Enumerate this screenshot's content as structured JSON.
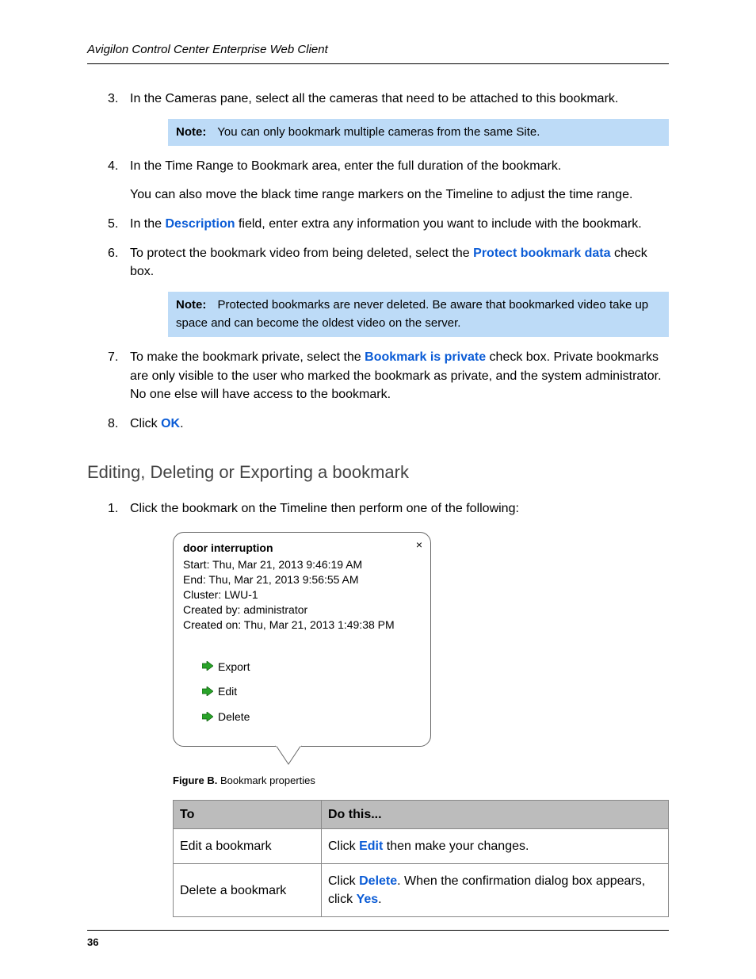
{
  "header": {
    "title": "Avigilon Control Center Enterprise Web Client"
  },
  "steps": {
    "3": {
      "num": "3.",
      "text": "In the Cameras pane, select all the cameras that need to be attached to this bookmark."
    },
    "note1": {
      "label": "Note:",
      "text": "You can only bookmark multiple cameras from the same Site."
    },
    "4": {
      "num": "4.",
      "text": "In the Time Range to Bookmark area, enter the full duration of the bookmark.",
      "after": "You can also move the black time range markers on the Timeline to adjust the time range."
    },
    "5": {
      "num": "5.",
      "pre": "In the ",
      "link": "Description",
      "post": " field, enter extra any information you want to include with the bookmark."
    },
    "6": {
      "num": "6.",
      "pre": "To protect the bookmark video from being deleted, select the ",
      "link": "Protect bookmark data",
      "post": " check box."
    },
    "note2": {
      "label": "Note:",
      "text": "Protected bookmarks are never deleted. Be aware that bookmarked video take up space and can become the oldest video on the server."
    },
    "7": {
      "num": "7.",
      "pre": "To make the bookmark private, select the ",
      "link": "Bookmark is private",
      "post": " check box. Private bookmarks are only visible to the user who marked the bookmark as private, and the system administrator. No one else will have access to the bookmark."
    },
    "8": {
      "num": "8.",
      "pre": "Click ",
      "link": "OK",
      "post": "."
    }
  },
  "section2": {
    "title": "Editing, Deleting or Exporting a bookmark",
    "step1": {
      "num": "1.",
      "text": "Click the bookmark on the Timeline then perform one of the following:"
    }
  },
  "popup": {
    "title": "door interruption",
    "line_start": "Start: Thu, Mar 21, 2013 9:46:19 AM",
    "line_end": "End: Thu, Mar 21, 2013 9:56:55 AM",
    "line_cluster": "Cluster: LWU-1",
    "line_createdby": "Created by: administrator",
    "line_createdon": "Created on: Thu, Mar 21, 2013 1:49:38 PM",
    "actions": {
      "export": "Export",
      "edit": "Edit",
      "delete": "Delete"
    },
    "close": "×"
  },
  "figure": {
    "label": "Figure B.",
    "caption": " Bookmark properties"
  },
  "table": {
    "head": {
      "c1": "To",
      "c2": "Do this..."
    },
    "rows": [
      {
        "c1": "Edit a bookmark",
        "c2_pre": "Click ",
        "c2_link": "Edit",
        "c2_post": " then make your changes."
      },
      {
        "c1": "Delete a bookmark",
        "c2_pre": "Click ",
        "c2_link": "Delete",
        "c2_mid": ". When the confirmation dialog box appears, click ",
        "c2_link2": "Yes",
        "c2_post": "."
      }
    ]
  },
  "page_number": "36"
}
